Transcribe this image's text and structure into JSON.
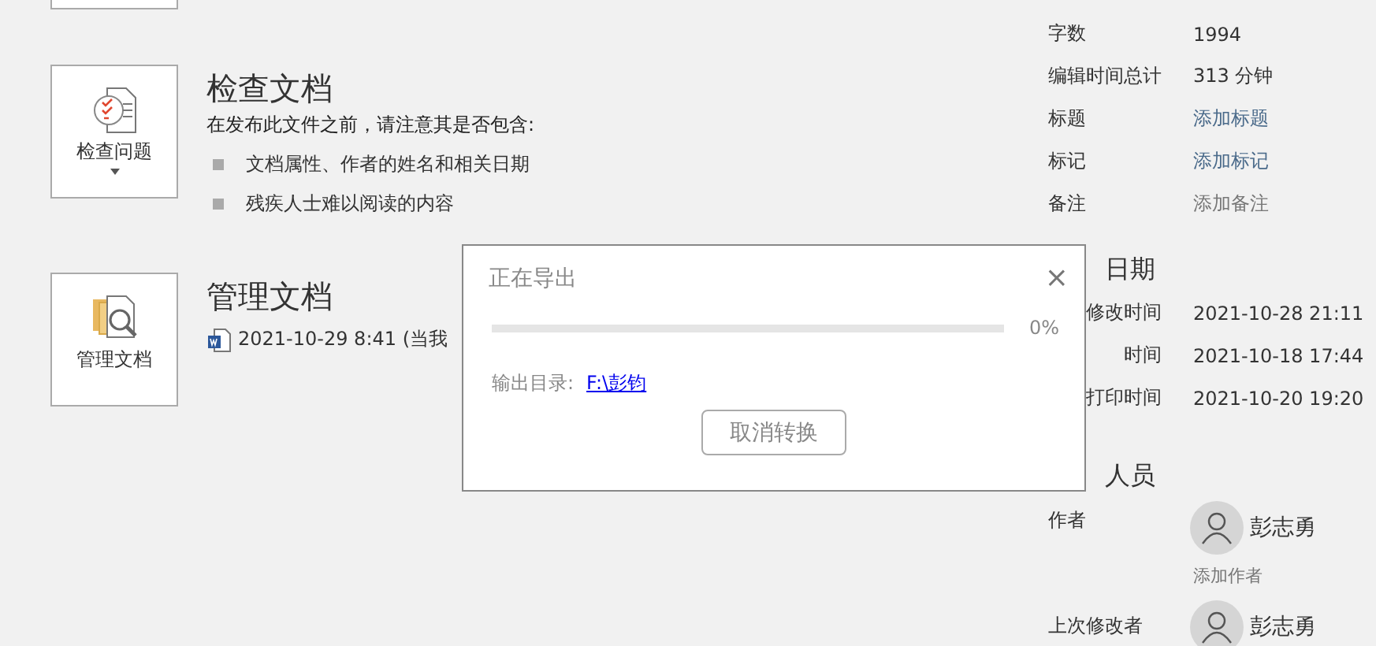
{
  "inspect": {
    "button_label": "检查问题",
    "title": "检查文档",
    "intro": "在发布此文件之前，请注意其是否包含:",
    "bullets": [
      "文档属性、作者的姓名和相关日期",
      "残疾人士难以阅读的内容"
    ]
  },
  "manage": {
    "button_label": "管理文档",
    "title": "管理文档",
    "version": "2021-10-29 8:41 (当我"
  },
  "properties": [
    {
      "label": "字数",
      "value": "1994",
      "kind": "text"
    },
    {
      "label": "编辑时间总计",
      "value": "313 分钟",
      "kind": "text"
    },
    {
      "label": "标题",
      "value": "添加标题",
      "kind": "add"
    },
    {
      "label": "标记",
      "value": "添加标记",
      "kind": "add"
    },
    {
      "label": "备注",
      "value": "添加备注",
      "kind": "hint"
    }
  ],
  "dates": {
    "heading": "日期",
    "rows": [
      {
        "label": "修改时间",
        "value": "2021-10-28 21:11"
      },
      {
        "label": "时间",
        "value": "2021-10-18 17:44"
      },
      {
        "label": "打印时间",
        "value": "2021-10-20 19:20"
      }
    ]
  },
  "people": {
    "heading": "人员",
    "rows": [
      {
        "label": "作者",
        "name": "彭志勇",
        "add": "添加作者"
      },
      {
        "label": "上次修改者",
        "name": "彭志勇"
      }
    ]
  },
  "dialog": {
    "title": "正在导出",
    "close": "×",
    "level": 0,
    "percent": "0%",
    "output_label": "输出目录:",
    "output_path": "F:\\彭钧",
    "cancel": "取消转换"
  }
}
